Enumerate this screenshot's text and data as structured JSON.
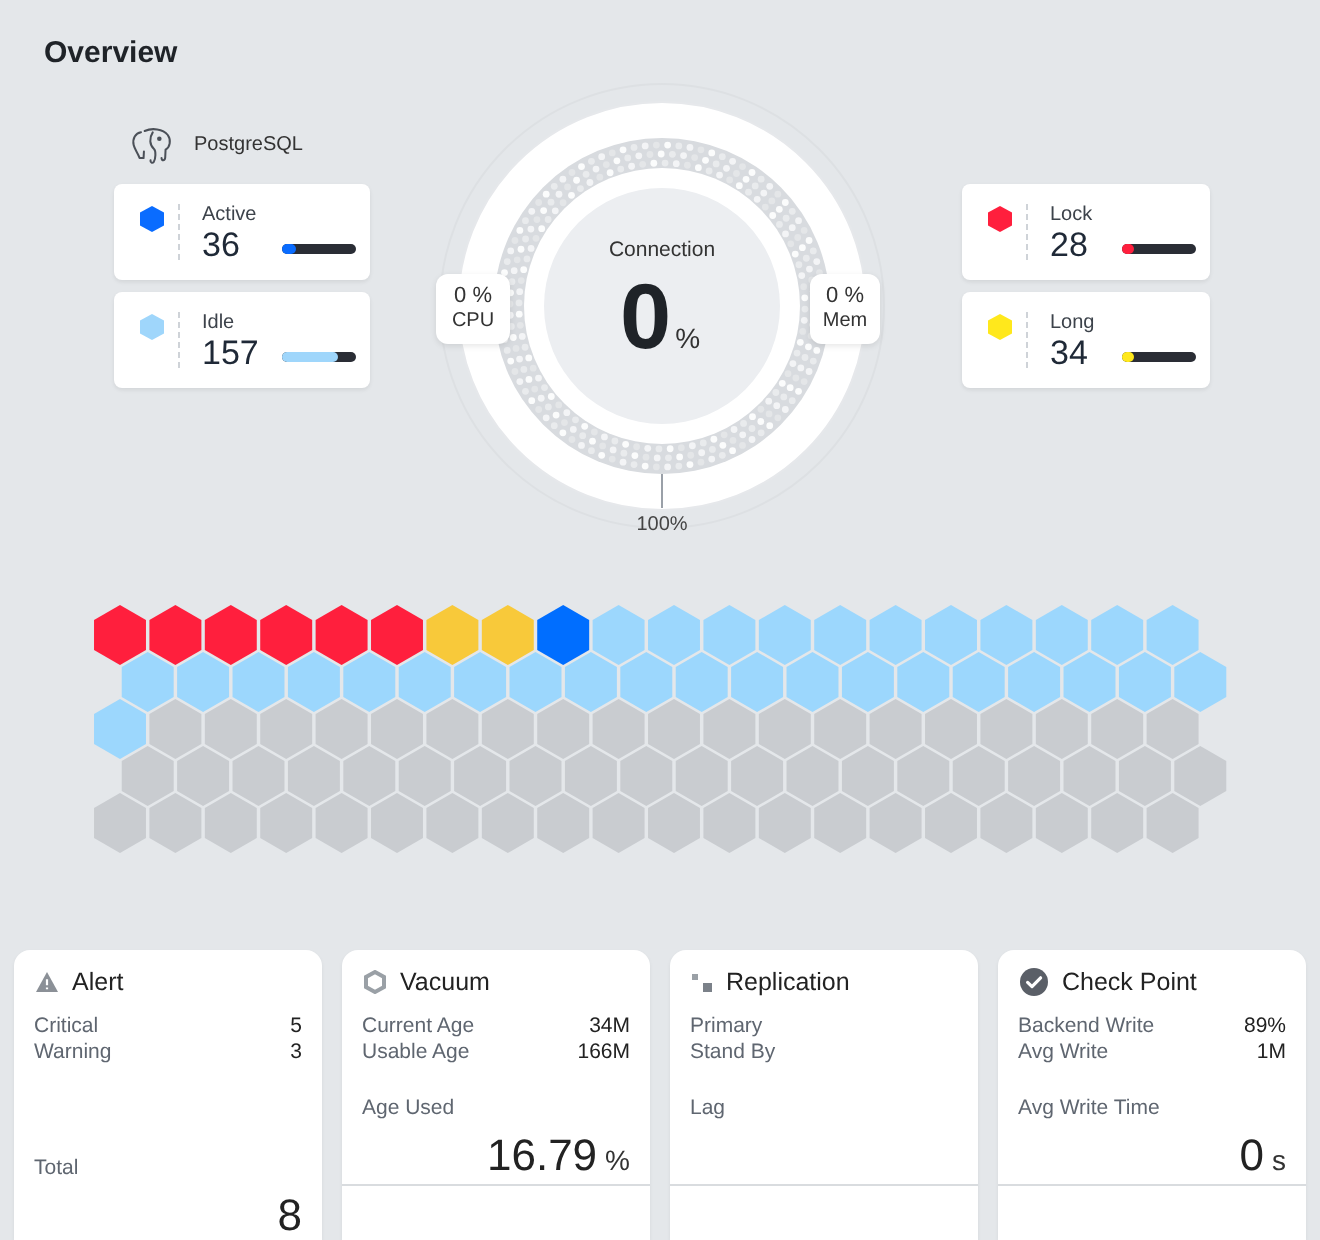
{
  "title": "Overview",
  "database": {
    "name": "PostgreSQL"
  },
  "metrics_left": [
    {
      "label": "Active",
      "value": "36",
      "color": "#0a6cff",
      "level": 0.18
    },
    {
      "label": "Idle",
      "value": "157",
      "color": "#9fd6fb",
      "level": 0.76
    }
  ],
  "gauge": {
    "label": "Connection",
    "value": "0",
    "unit": "%",
    "badges": [
      {
        "value": "0 %",
        "label": "CPU"
      },
      {
        "value": "0 %",
        "label": "Mem"
      }
    ],
    "scale_label": "100%"
  },
  "metrics_right": [
    {
      "label": "Lock",
      "value": "28",
      "color": "#ff1f3d",
      "level": 0.17
    },
    {
      "label": "Long",
      "value": "34",
      "color": "#ffe81c",
      "level": 0.15
    }
  ],
  "hex_grid": {
    "cells": [
      {
        "color": "#ff1f3d"
      },
      {
        "color": "#ff1f3d"
      },
      {
        "color": "#ff1f3d"
      },
      {
        "color": "#ff1f3d"
      },
      {
        "color": "#ff1f3d"
      },
      {
        "color": "#ff1f3d"
      },
      {
        "color": "#f8c93a"
      },
      {
        "color": "#f8c93a"
      },
      {
        "color": "#006eff"
      },
      {
        "color": "#9cd7fd"
      },
      {
        "color": "#9cd7fd"
      },
      {
        "color": "#9cd7fd"
      },
      {
        "color": "#9cd7fd"
      },
      {
        "color": "#9cd7fd"
      },
      {
        "color": "#9cd7fd"
      },
      {
        "color": "#9cd7fd"
      },
      {
        "color": "#9cd7fd"
      },
      {
        "color": "#9cd7fd"
      },
      {
        "color": "#9cd7fd"
      },
      {
        "color": "#9cd7fd"
      },
      {
        "color": "#9cd7fd"
      },
      {
        "color": "#9cd7fd"
      },
      {
        "color": "#9cd7fd"
      },
      {
        "color": "#9cd7fd"
      },
      {
        "color": "#9cd7fd"
      },
      {
        "color": "#9cd7fd"
      },
      {
        "color": "#9cd7fd"
      },
      {
        "color": "#9cd7fd"
      },
      {
        "color": "#9cd7fd"
      },
      {
        "color": "#9cd7fd"
      },
      {
        "color": "#9cd7fd"
      },
      {
        "color": "#9cd7fd"
      },
      {
        "color": "#9cd7fd"
      },
      {
        "color": "#9cd7fd"
      },
      {
        "color": "#9cd7fd"
      },
      {
        "color": "#9cd7fd"
      },
      {
        "color": "#9cd7fd"
      },
      {
        "color": "#9cd7fd"
      },
      {
        "color": "#9cd7fd"
      },
      {
        "color": "#9cd7fd"
      },
      {
        "color": "#9cd7fd"
      },
      {
        "color": "#c9ccd0"
      },
      {
        "color": "#c9ccd0"
      },
      {
        "color": "#c9ccd0"
      },
      {
        "color": "#c9ccd0"
      },
      {
        "color": "#c9ccd0"
      },
      {
        "color": "#c9ccd0"
      },
      {
        "color": "#c9ccd0"
      },
      {
        "color": "#c9ccd0"
      },
      {
        "color": "#c9ccd0"
      },
      {
        "color": "#c9ccd0"
      },
      {
        "color": "#c9ccd0"
      },
      {
        "color": "#c9ccd0"
      },
      {
        "color": "#c9ccd0"
      },
      {
        "color": "#c9ccd0"
      },
      {
        "color": "#c9ccd0"
      },
      {
        "color": "#c9ccd0"
      },
      {
        "color": "#c9ccd0"
      },
      {
        "color": "#c9ccd0"
      },
      {
        "color": "#c9ccd0"
      },
      {
        "color": "#c9ccd0"
      },
      {
        "color": "#c9ccd0"
      },
      {
        "color": "#c9ccd0"
      },
      {
        "color": "#c9ccd0"
      },
      {
        "color": "#c9ccd0"
      },
      {
        "color": "#c9ccd0"
      },
      {
        "color": "#c9ccd0"
      },
      {
        "color": "#c9ccd0"
      },
      {
        "color": "#c9ccd0"
      },
      {
        "color": "#c9ccd0"
      },
      {
        "color": "#c9ccd0"
      },
      {
        "color": "#c9ccd0"
      },
      {
        "color": "#c9ccd0"
      },
      {
        "color": "#c9ccd0"
      },
      {
        "color": "#c9ccd0"
      },
      {
        "color": "#c9ccd0"
      },
      {
        "color": "#c9ccd0"
      },
      {
        "color": "#c9ccd0"
      },
      {
        "color": "#c9ccd0"
      },
      {
        "color": "#c9ccd0"
      },
      {
        "color": "#c9ccd0"
      },
      {
        "color": "#c9ccd0"
      },
      {
        "color": "#c9ccd0"
      },
      {
        "color": "#c9ccd0"
      },
      {
        "color": "#c9ccd0"
      },
      {
        "color": "#c9ccd0"
      },
      {
        "color": "#c9ccd0"
      },
      {
        "color": "#c9ccd0"
      },
      {
        "color": "#c9ccd0"
      },
      {
        "color": "#c9ccd0"
      },
      {
        "color": "#c9ccd0"
      },
      {
        "color": "#c9ccd0"
      },
      {
        "color": "#c9ccd0"
      },
      {
        "color": "#c9ccd0"
      },
      {
        "color": "#c9ccd0"
      },
      {
        "color": "#c9ccd0"
      },
      {
        "color": "#c9ccd0"
      },
      {
        "color": "#c9ccd0"
      },
      {
        "color": "#c9ccd0"
      },
      {
        "color": "#c9ccd0"
      }
    ]
  },
  "cards": [
    {
      "kind": "alert",
      "title": "Alert",
      "rows": [
        {
          "label": "Critical",
          "value": "5"
        },
        {
          "label": "Warning",
          "value": "3"
        }
      ],
      "summary": {
        "label": "Total",
        "value": "8"
      }
    },
    {
      "kind": "vacuum",
      "title": "Vacuum",
      "rows": [
        {
          "label": "Current Age",
          "value": "34M"
        },
        {
          "label": "Usable Age",
          "value": "166M"
        }
      ],
      "summary": {
        "label": "Age Used",
        "value": "16.79",
        "unit": "%"
      }
    },
    {
      "kind": "replication",
      "title": "Replication",
      "rows": [
        {
          "label": "Primary"
        },
        {
          "label": "Stand By"
        }
      ],
      "summary": {
        "label": "Lag"
      }
    },
    {
      "kind": "checkpoint",
      "title": "Check Point",
      "rows": [
        {
          "label": "Backend Write",
          "value": "89%"
        },
        {
          "label": "Avg Write",
          "value": "1M"
        }
      ],
      "summary": {
        "label": "Avg Write Time",
        "value": "0",
        "unit": "s"
      }
    }
  ]
}
